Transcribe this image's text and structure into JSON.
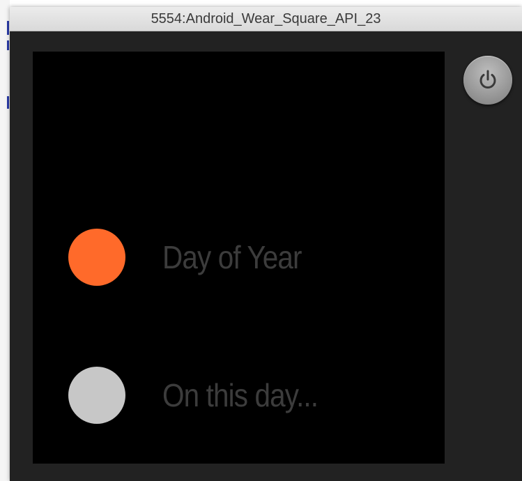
{
  "window": {
    "title": "5554:Android_Wear_Square_API_23"
  },
  "emulator": {
    "power_button_icon": "power-icon",
    "options": [
      {
        "label": "Day of Year",
        "dot_color": "#FF6A2A",
        "dot_icon": "circle-icon"
      },
      {
        "label": "On this day...",
        "dot_color": "#C7C7C7",
        "dot_icon": "circle-icon"
      }
    ]
  },
  "colors": {
    "accent": "#FF6A2A",
    "inactive": "#C7C7C7",
    "label_text": "#3C3C3C",
    "frame": "#222222",
    "screen": "#000000"
  }
}
